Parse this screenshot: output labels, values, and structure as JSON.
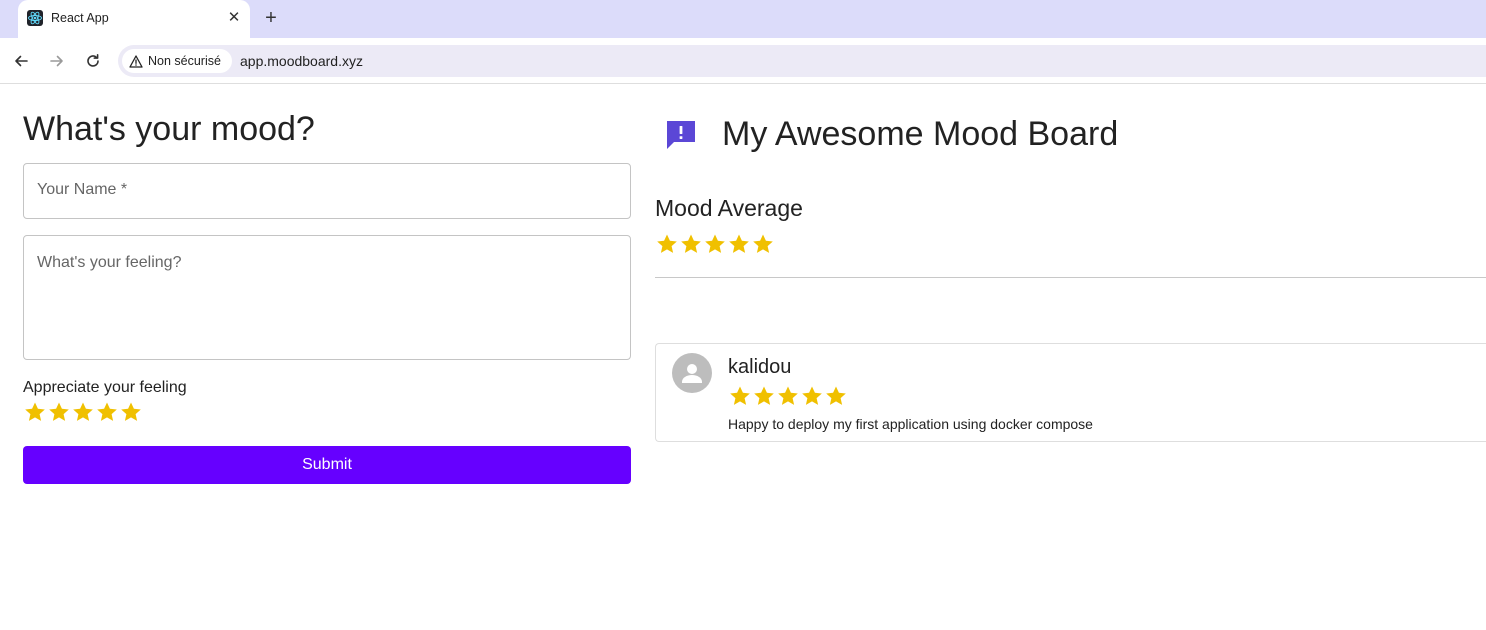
{
  "browser": {
    "tab_title": "React App",
    "tab_close": "✕",
    "new_tab": "+",
    "security_label": "Non sécurisé",
    "url": "app.moodboard.xyz"
  },
  "form": {
    "title": "What's your mood?",
    "name_placeholder": "Your Name *",
    "feeling_placeholder": "What's your feeling?",
    "rating_label": "Appreciate your feeling",
    "rating": 5,
    "rating_max": 5,
    "submit_label": "Submit"
  },
  "board": {
    "title": "My Awesome Mood Board",
    "average_title": "Mood Average",
    "average_rating": 5,
    "average_max": 5,
    "entries": [
      {
        "name": "kalidou",
        "rating": 5,
        "rating_max": 5,
        "text": "Happy to deploy my first application using docker compose"
      }
    ]
  },
  "colors": {
    "accent": "#6600ff",
    "star": "#f0c000",
    "board_icon": "#5b47d6",
    "avatar": "#bdbdbd"
  }
}
